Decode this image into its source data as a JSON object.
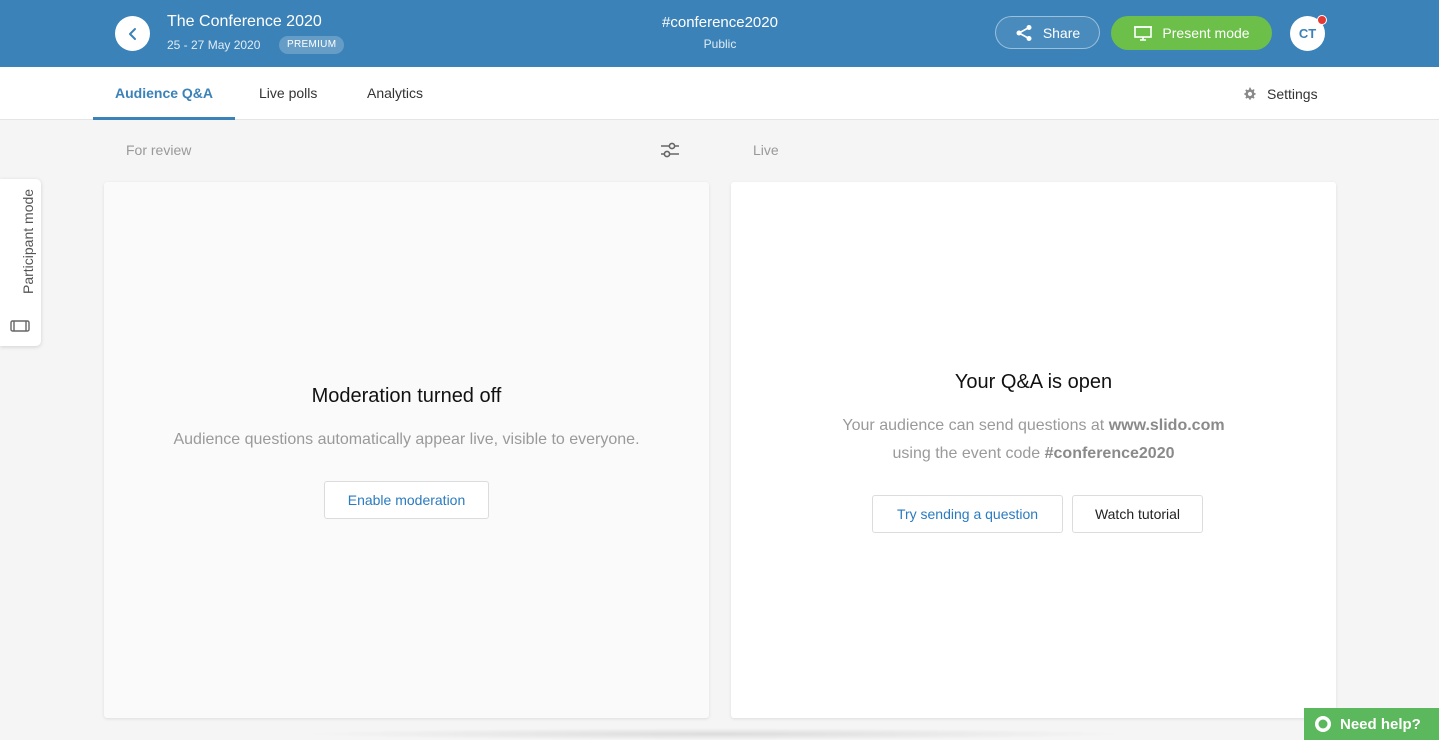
{
  "header": {
    "event_title": "The Conference 2020",
    "event_dates": "25 - 27 May 2020",
    "plan_badge": "PREMIUM",
    "event_code": "#conference2020",
    "privacy": "Public",
    "share_label": "Share",
    "present_label": "Present mode",
    "avatar_initials": "CT"
  },
  "tabs": [
    {
      "label": "Audience Q&A",
      "active": true
    },
    {
      "label": "Live polls",
      "active": false
    },
    {
      "label": "Analytics",
      "active": false
    }
  ],
  "settings_label": "Settings",
  "columns": {
    "review_label": "For review",
    "live_label": "Live"
  },
  "review_panel": {
    "title": "Moderation turned off",
    "text": "Audience questions automatically appear live, visible to everyone.",
    "button": "Enable moderation"
  },
  "live_panel": {
    "title": "Your Q&A is open",
    "line1_prefix": "Your audience can send questions at ",
    "line1_strong": "www.slido.com",
    "line2_prefix": "using the event code ",
    "line2_strong": "#conference2020",
    "try_button": "Try sending a question",
    "tutorial_button": "Watch tutorial"
  },
  "participant_mode_label": "Participant mode",
  "help_label": "Need help?",
  "colors": {
    "brand_blue": "#3b82b8",
    "present_green": "#6cc04a",
    "help_green": "#5cb85c",
    "notification_red": "#e53935"
  },
  "icons": [
    "chevron-left-icon",
    "share-icon",
    "presentation-icon",
    "gear-icon",
    "sliders-icon",
    "device-icon",
    "chat-bubble-icon"
  ]
}
